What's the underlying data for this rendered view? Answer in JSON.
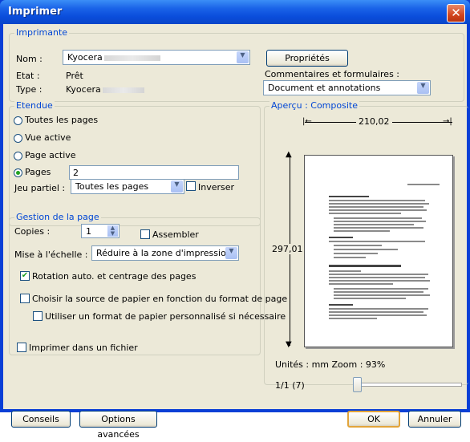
{
  "window": {
    "title": "Imprimer"
  },
  "printer": {
    "legend": "Imprimante",
    "name_label": "Nom :",
    "name_value": "Kyocera",
    "status_label": "Etat :",
    "status_value": "Prêt",
    "type_label": "Type :",
    "type_value": "Kyocera",
    "properties_button": "Propriétés",
    "comments_label": "Commentaires et formulaires :",
    "comments_value": "Document et annotations"
  },
  "range": {
    "legend": "Etendue",
    "all_pages": "Toutes les pages",
    "current_view": "Vue active",
    "current_page": "Page active",
    "pages_label": "Pages",
    "pages_value": "2",
    "selected": "pages",
    "subset_label": "Jeu partiel :",
    "subset_value": "Toutes les pages",
    "reverse_label": "Inverser"
  },
  "page_handling": {
    "legend": "Gestion de la page",
    "copies_label": "Copies :",
    "copies_value": "1",
    "collate_label": "Assembler",
    "scaling_label": "Mise à l'échelle :",
    "scaling_value": "Réduire à la zone d'impression",
    "auto_rotate_label": "Rotation auto. et centrage des pages",
    "auto_rotate_checked": true,
    "paper_source_label": "Choisir la source de papier en fonction du format de page",
    "custom_paper_label": "Utiliser un format de papier personnalisé si nécessaire"
  },
  "print_to_file_label": "Imprimer dans un fichier",
  "preview": {
    "legend": "Aperçu : Composite",
    "width_value": "210,02",
    "height_value": "297,01",
    "units_zoom": "Unités : mm Zoom :  93%",
    "page_counter": "1/1 (7)",
    "slider_position": 0
  },
  "footer": {
    "tips_button": "Conseils",
    "advanced_button": "Options avancées",
    "ok_button": "OK",
    "cancel_button": "Annuler"
  }
}
